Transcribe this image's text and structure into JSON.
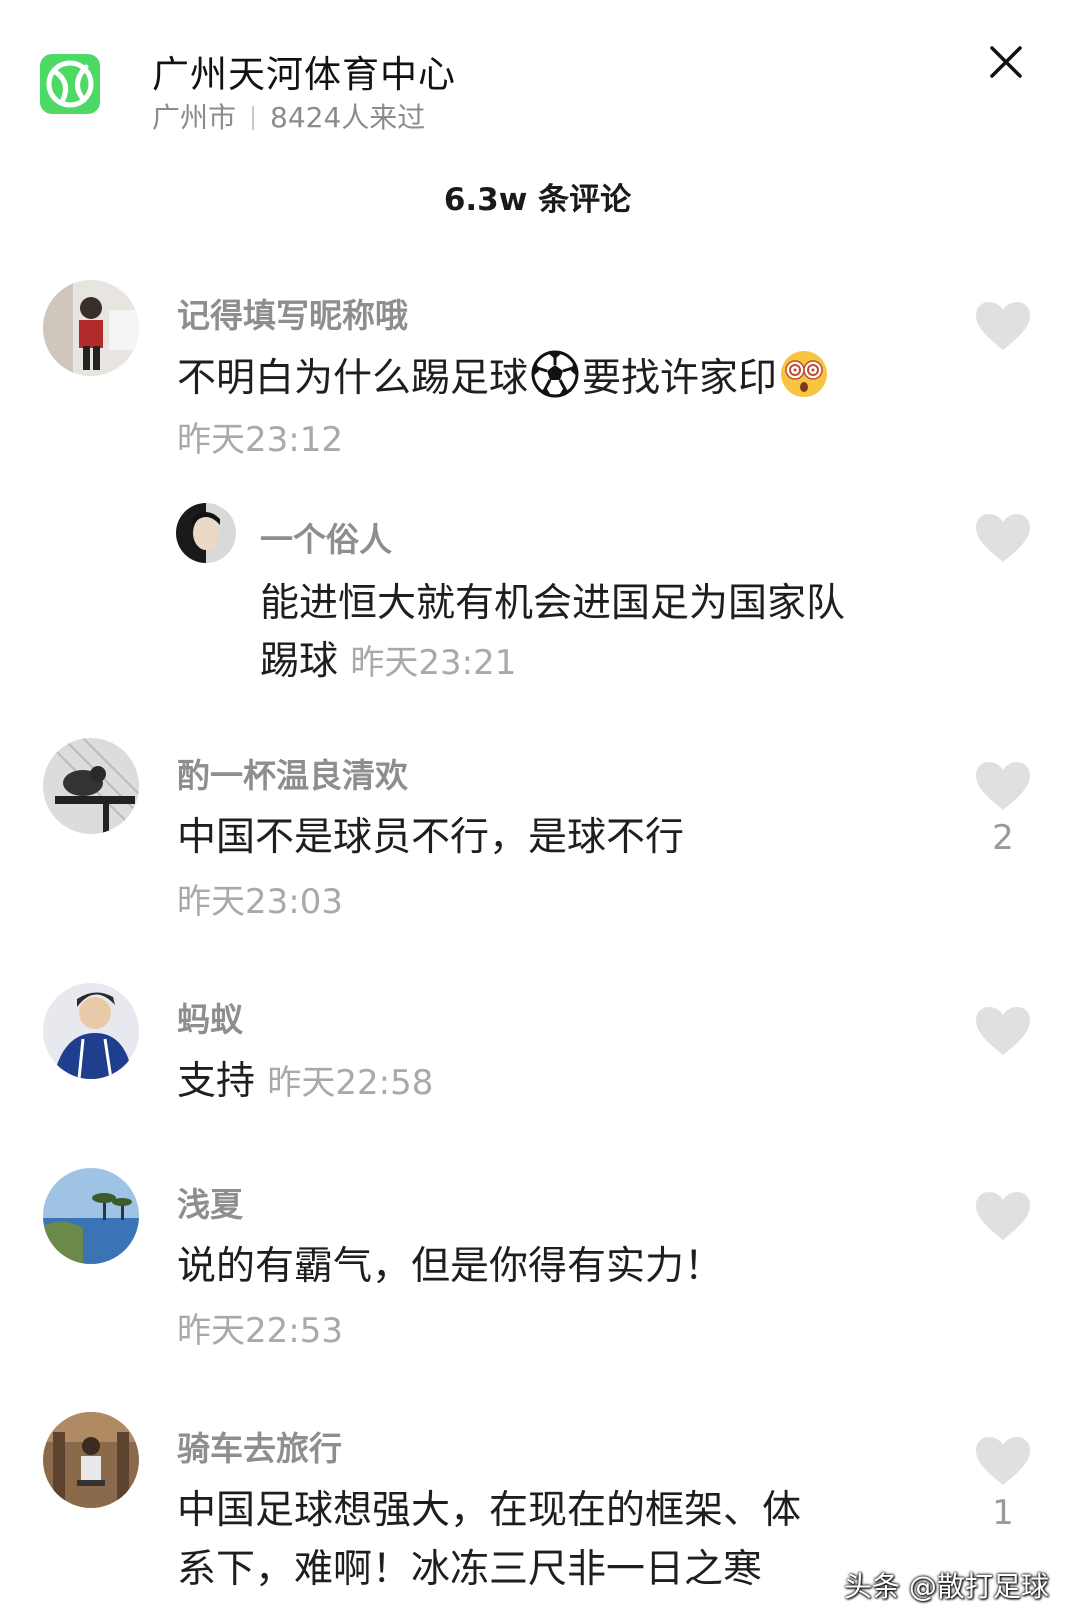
{
  "header": {
    "location_name": "广州天河体育中心",
    "city": "广州市",
    "visitors": "8424人来过",
    "comment_count_title": "6.3w 条评论",
    "icon": "tennis-ball-icon",
    "accent_color": "#4cd964"
  },
  "comments": [
    {
      "username": "记得填写昵称哦",
      "text_part1": "不明白为什么踢足球",
      "text_part2": "要找许家印",
      "emojis": [
        "soccer-ball-emoji",
        "dizzy-face-emoji"
      ],
      "time": "昨天23:12",
      "likes": "",
      "reply": {
        "username": "一个俗人",
        "line1": "能进恒大就有机会进国足为国家队",
        "line2": "踢球",
        "time": "昨天23:21"
      }
    },
    {
      "username": "酌一杯温良清欢",
      "text": "中国不是球员不行，是球不行",
      "time": "昨天23:03",
      "likes": "2"
    },
    {
      "username": "蚂蚁",
      "text": "支持",
      "time": "昨天22:58",
      "likes": ""
    },
    {
      "username": "浅夏",
      "text": "说的有霸气，但是你得有实力！",
      "time": "昨天22:53",
      "likes": ""
    },
    {
      "username": "骑车去旅行",
      "line1": "中国足球想强大，在现在的框架、体",
      "line2": "系下，难啊！冰冻三尺非一日之寒",
      "likes": "1"
    }
  ],
  "watermark": "头条 @散打足球"
}
